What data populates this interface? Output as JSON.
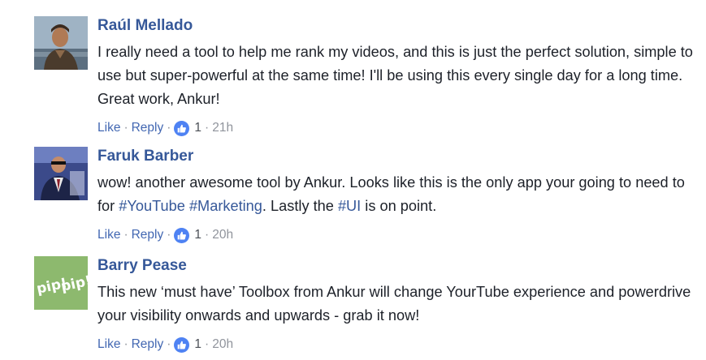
{
  "comments": [
    {
      "author": "Raúl Mellado",
      "avatar_icon": "profile-photo-man-outdoors",
      "text_parts": [
        {
          "t": "I really need a tool to help me rank my videos, and this is just the perfect solution, simple to use but super-powerful at the same time! I'll be using this every single day for a long time. Great work, Ankur!",
          "tag": false
        }
      ],
      "like_label": "Like",
      "reply_label": "Reply",
      "reaction_icon": "thumbs-up-icon",
      "like_count": "1",
      "time": "21h"
    },
    {
      "author": "Faruk Barber",
      "avatar_icon": "profile-photo-man-suit",
      "text_parts": [
        {
          "t": "wow! another awesome tool by Ankur. Looks like this is the only app your going to need to for ",
          "tag": false
        },
        {
          "t": "#YouTube",
          "tag": true
        },
        {
          "t": " ",
          "tag": false
        },
        {
          "t": "#Marketing",
          "tag": true
        },
        {
          "t": ". Lastly the ",
          "tag": false
        },
        {
          "t": "#UI",
          "tag": true
        },
        {
          "t": " is on point.",
          "tag": false
        }
      ],
      "like_label": "Like",
      "reply_label": "Reply",
      "reaction_icon": "thumbs-up-icon",
      "like_count": "1",
      "time": "20h"
    },
    {
      "author": "Barry Pease",
      "avatar_icon": "pip-pip-logo",
      "avatar_text": "pip! pip!",
      "text_parts": [
        {
          "t": "This new ‘must have’ Toolbox from Ankur will change YourTube experience and powerdrive your visibility onwards and upwards - grab it now!",
          "tag": false
        }
      ],
      "like_label": "Like",
      "reply_label": "Reply",
      "reaction_icon": "thumbs-up-icon",
      "like_count": "1",
      "time": "20h"
    }
  ],
  "separator": "·",
  "colors": {
    "link": "#365899",
    "action": "#4267b2",
    "meta": "#90949c",
    "reaction": "#4e82f3",
    "avatar_green": "#8db96e"
  }
}
